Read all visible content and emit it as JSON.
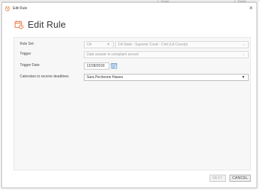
{
  "background": {
    "fragments": [
      "Trigger",
      "Trigger"
    ]
  },
  "window": {
    "title": "Edit Rule",
    "close_glyph": "×",
    "app_icon": "calendar-alarm-icon"
  },
  "heading": {
    "text": "Edit Rule",
    "icon": "calendar-alarm-icon"
  },
  "form": {
    "rule_set": {
      "label": "Rule Set",
      "jurisdiction": "CA",
      "court": "CA State - Superior Court - Civil (LA County)"
    },
    "trigger": {
      "label": "Trigger",
      "value": "Date answer to complaint served"
    },
    "trigger_date": {
      "label": "Trigger Date",
      "value": "12/28/2018",
      "icon": "calendar-icon"
    },
    "calendars": {
      "label": "Calendars to receive deadlines",
      "value": "Sara Pecheone Hawes"
    }
  },
  "footer": {
    "next_label": "NEXT",
    "cancel_label": "CANCEL"
  },
  "colors": {
    "accent_orange": "#e8743b",
    "border": "#c8c8c8",
    "panel": "#f7f7f7"
  }
}
